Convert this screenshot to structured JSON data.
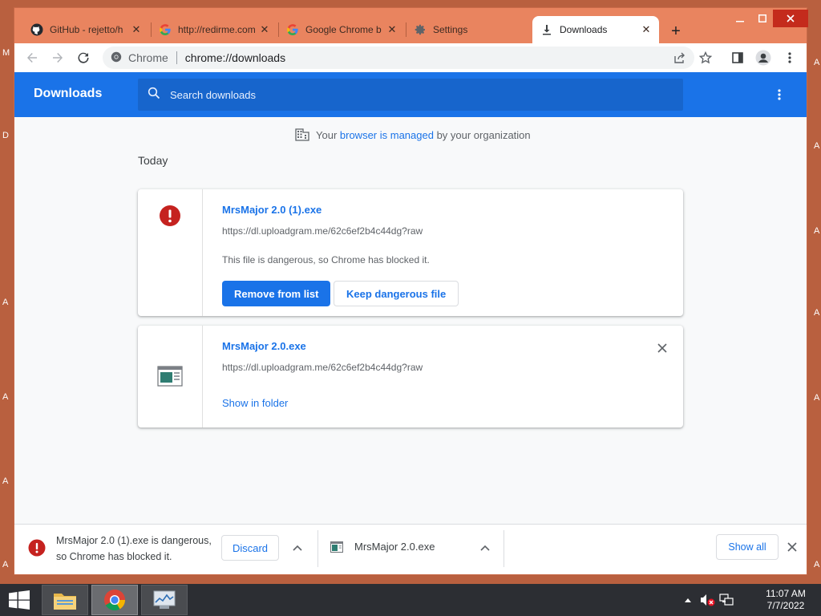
{
  "desktop": {
    "edge_letters": [
      "M",
      "D",
      "A",
      "A",
      "A",
      "A",
      "A",
      "A",
      "A",
      "A",
      "A",
      "A"
    ]
  },
  "tabs": [
    {
      "title": "GitHub - rejetto/h",
      "favicon": "github-icon",
      "active": false
    },
    {
      "title": "http://redirme.com",
      "favicon": "google-icon",
      "active": false
    },
    {
      "title": "Google Chrome b",
      "favicon": "google-icon",
      "active": false
    },
    {
      "title": "Settings",
      "favicon": "gear-icon",
      "active": false
    },
    {
      "title": "Downloads",
      "favicon": "download-icon",
      "active": true
    }
  ],
  "omnibox": {
    "chip": "Chrome",
    "url": "chrome://downloads"
  },
  "header": {
    "title": "Downloads",
    "search_placeholder": "Search downloads"
  },
  "managed_notice": {
    "prefix": "Your ",
    "link": "browser is managed",
    "suffix": " by your organization"
  },
  "date_heading": "Today",
  "downloads": [
    {
      "name": "MrsMajor 2.0 (1).exe",
      "url": "https://dl.uploadgram.me/62c6ef2b4c44dg?raw",
      "warning": "This file is dangerous, so Chrome has blocked it.",
      "primary_action": "Remove from list",
      "secondary_action": "Keep dangerous file"
    },
    {
      "name": "MrsMajor 2.0.exe",
      "url": "https://dl.uploadgram.me/62c6ef2b4c44dg?raw",
      "action": "Show in folder"
    }
  ],
  "shelf": {
    "item1_text": "MrsMajor 2.0 (1).exe is dangerous, so Chrome has blocked it.",
    "discard_label": "Discard",
    "item2_name": "MrsMajor 2.0.exe",
    "show_all_label": "Show all"
  },
  "taskbar": {
    "time": "11:07 AM",
    "date": "7/7/2022"
  },
  "colors": {
    "desktop": "#b9603f",
    "chrome_frame": "#e9845f",
    "accent_blue": "#1a73e8",
    "danger_red": "#c5221f",
    "taskbar": "#2c2e33"
  }
}
